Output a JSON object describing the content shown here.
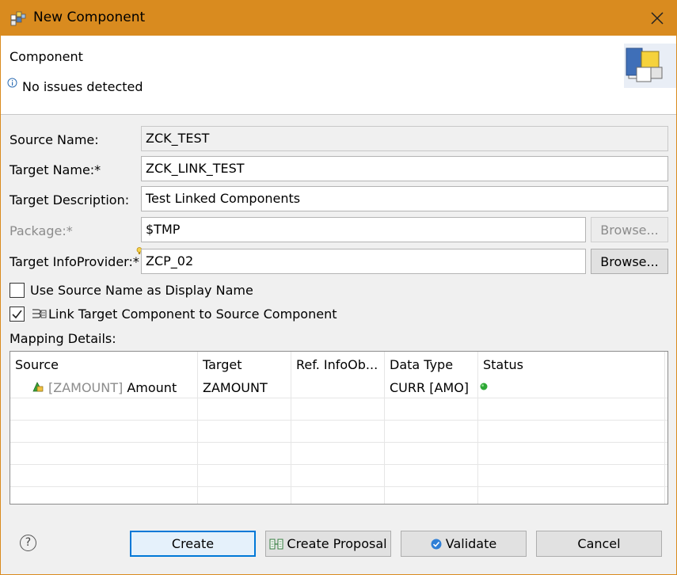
{
  "window": {
    "title": "New Component",
    "title_icon": "component-wizard-icon"
  },
  "header": {
    "title": "Component",
    "message": "No issues detected"
  },
  "form": {
    "source_name": {
      "label": "Source Name:",
      "value": "ZCK_TEST"
    },
    "target_name": {
      "label": "Target Name:*",
      "value": "ZCK_LINK_TEST"
    },
    "target_description": {
      "label": "Target Description:",
      "value": "Test Linked Components"
    },
    "package": {
      "label": "Package:*",
      "value": "$TMP",
      "browse_label": "Browse..."
    },
    "target_infoprovider": {
      "label": "Target InfoProvider:*",
      "value": "ZCP_02",
      "browse_label": "Browse..."
    },
    "use_source_name": {
      "label": "Use Source Name as Display Name",
      "checked": false
    },
    "link_target": {
      "label": "Link Target Component to Source Component",
      "checked": true
    }
  },
  "mapping": {
    "label": "Mapping Details:",
    "columns": [
      "Source",
      "Target",
      "Ref. InfoOb...",
      "Data Type",
      "Status"
    ],
    "rows": [
      {
        "source_key": "[ZAMOUNT]",
        "source_name": "Amount",
        "target": "ZAMOUNT",
        "ref": "",
        "data_type": "CURR [AMO]",
        "status": "ok"
      }
    ]
  },
  "buttons": {
    "create": "Create",
    "create_proposal": "Create Proposal",
    "validate": "Validate",
    "cancel": "Cancel"
  },
  "colors": {
    "titlebar": "#d98b1f",
    "accent": "#0078d7",
    "status_ok": "#2ea836"
  }
}
